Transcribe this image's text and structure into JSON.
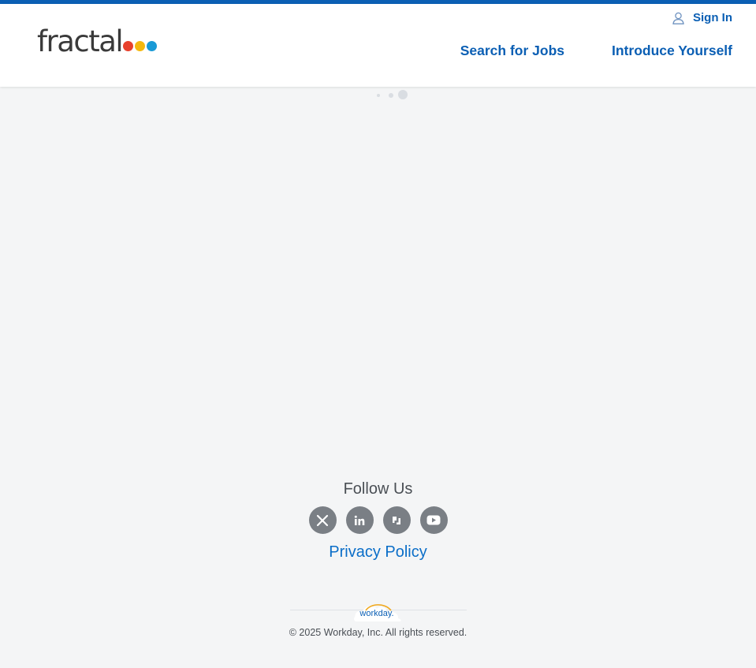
{
  "header": {
    "logo_text": "fractal",
    "logo_dot_colors": [
      "#e8412c",
      "#f5b80f",
      "#1a9ad6"
    ],
    "signin_label": "Sign In",
    "nav": {
      "search_jobs": "Search for Jobs",
      "introduce": "Introduce Yourself"
    }
  },
  "footer": {
    "follow_label": "Follow Us",
    "social_icons": [
      "x-icon",
      "linkedin-icon",
      "glassdoor-icon",
      "youtube-icon"
    ],
    "privacy_label": "Privacy Policy",
    "workday_logo_text": "workday.",
    "copyright": "© 2025 Workday, Inc. All rights reserved."
  },
  "colors": {
    "brand_blue": "#0b5fb4",
    "background": "#f4f5f6",
    "social_gray": "#7a7f85"
  }
}
